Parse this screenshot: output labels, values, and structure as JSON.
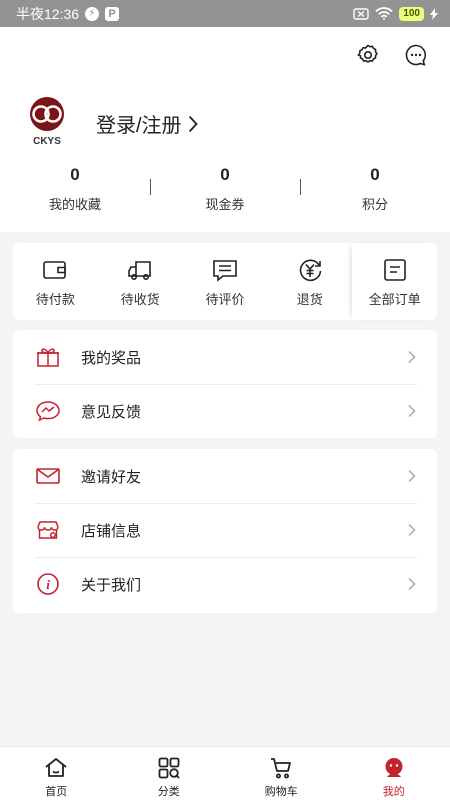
{
  "status_bar": {
    "time": "半夜12:36",
    "battery": "100"
  },
  "profile": {
    "login_label": "登录/注册",
    "logo_text": "CKYS"
  },
  "stats": [
    {
      "value": "0",
      "label": "我的收藏"
    },
    {
      "value": "0",
      "label": "现金券"
    },
    {
      "value": "0",
      "label": "积分"
    }
  ],
  "orders": [
    {
      "label": "待付款",
      "icon": "wallet-icon"
    },
    {
      "label": "待收货",
      "icon": "truck-icon"
    },
    {
      "label": "待评价",
      "icon": "comment-icon"
    },
    {
      "label": "退货",
      "icon": "yuan-return-icon"
    },
    {
      "label": "全部订单",
      "icon": "order-list-icon"
    }
  ],
  "menu_group_1": [
    {
      "label": "我的奖品",
      "icon": "gift-icon"
    },
    {
      "label": "意见反馈",
      "icon": "feedback-icon"
    }
  ],
  "menu_group_2": [
    {
      "label": "邀请好友",
      "icon": "mail-icon"
    },
    {
      "label": "店铺信息",
      "icon": "store-icon"
    },
    {
      "label": "关于我们",
      "icon": "info-icon"
    }
  ],
  "tabs": [
    {
      "label": "首页",
      "icon": "home-icon"
    },
    {
      "label": "分类",
      "icon": "category-icon"
    },
    {
      "label": "购物车",
      "icon": "cart-icon"
    },
    {
      "label": "我的",
      "icon": "profile-icon"
    }
  ],
  "colors": {
    "accent": "#c4222e",
    "status_bar": "#939393",
    "background": "#f4f3f5"
  }
}
